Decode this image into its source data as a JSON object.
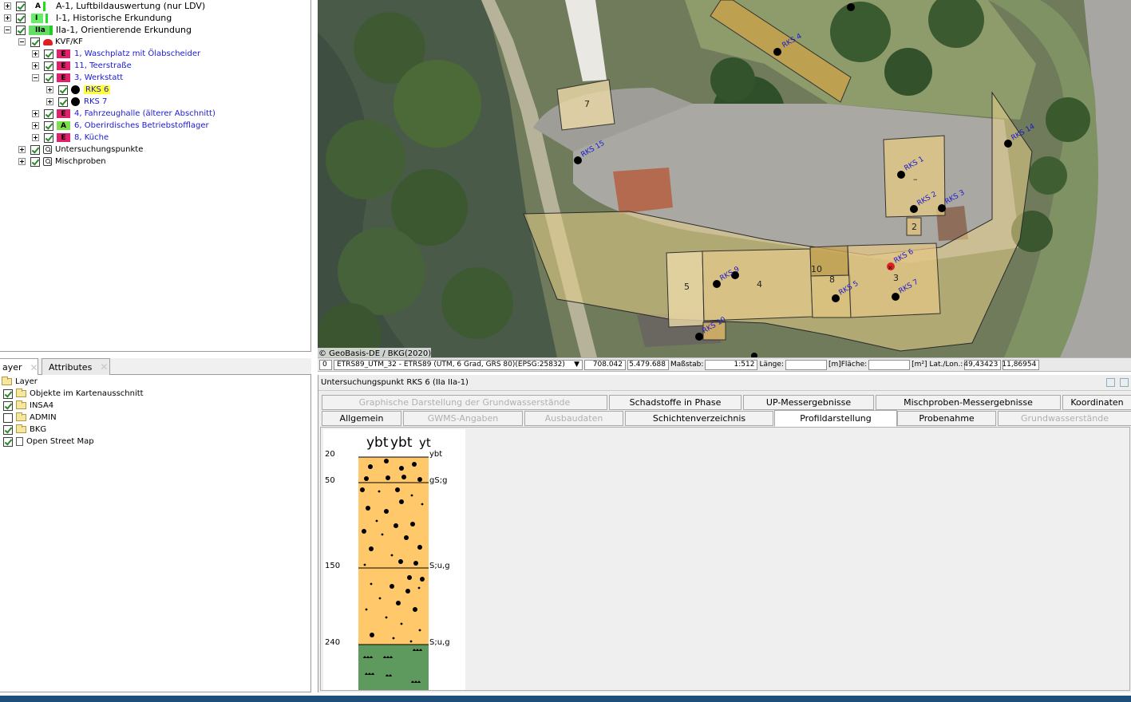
{
  "tree": {
    "items": [
      {
        "phase": "A",
        "label": "A-1, Luftbildauswertung (nur LDV)"
      },
      {
        "phase": "I",
        "label": "I-1, Historische Erkundung"
      },
      {
        "phase": "IIa",
        "label": "IIa-1, Orientierende Erkundung"
      },
      {
        "label": "KVF/KF"
      },
      {
        "badge": "E",
        "label": "1, Waschplatz mit Ölabscheider"
      },
      {
        "badge": "E",
        "label": "11, Teerstraße"
      },
      {
        "badge": "E",
        "label": "3, Werkstatt"
      },
      {
        "label": "RKS 6"
      },
      {
        "label": "RKS 7"
      },
      {
        "badge": "E",
        "label": "4, Fahrzeughalle (älterer Abschnitt)"
      },
      {
        "badge": "A",
        "label": "6, Oberirdisches Betriebstofflager"
      },
      {
        "badge": "E",
        "label": "8, Küche"
      },
      {
        "label": "Untersuchungspunkte"
      },
      {
        "label": "Mischproben"
      }
    ]
  },
  "layer_tabs": [
    "ayer",
    "Attributes"
  ],
  "layers": [
    {
      "label": "Layer",
      "checked": null
    },
    {
      "label": "Objekte im Kartenausschnitt",
      "checked": true
    },
    {
      "label": "INSA4",
      "checked": true
    },
    {
      "label": "ADMIN",
      "checked": false
    },
    {
      "label": "BKG",
      "checked": true
    },
    {
      "label": "Open Street Map",
      "checked": true
    }
  ],
  "map": {
    "copyright": "© GeoBasis-DE / BKG(2020)",
    "points": [
      "RKS 1",
      "RKS 2",
      "RKS 3",
      "RKS 4",
      "RKS 5",
      "RKS 6",
      "RKS 7",
      "RKS 9",
      "RKS 10",
      "RKS 14",
      "RKS 15"
    ],
    "areas": [
      "2",
      "3",
      "4",
      "5",
      "7",
      "8",
      "10"
    ]
  },
  "statusbar": {
    "zero": "0",
    "crs": "ETRS89_UTM_32 - ETRS89 (UTM, 6 Grad, GRS 80)(EPSG:25832)",
    "x": "708.042",
    "y": "5.479.688",
    "scale_label": "Maßstab:",
    "scale": "1:512",
    "length_label": "Länge:",
    "area_label": "[m]Fläche:",
    "latlon_label": "[m²] Lat./Lon.:",
    "lat": "49,43423",
    "lon": "11,86954"
  },
  "detail": {
    "title": "Untersuchungspunkt RKS 6 (IIa IIa-1)",
    "tabs_row1": [
      "Graphische Darstellung der Grundwasserstände",
      "Schadstoffe in Phase",
      "UP-Messergebnisse",
      "Mischproben-Messergebnisse",
      "Koordinaten"
    ],
    "tabs_row2": [
      "Allgemein",
      "GWMS-Angaben",
      "Ausbaudaten",
      "Schichtenverzeichnis",
      "Profildarstellung",
      "Probenahme",
      "Grundwasserstände"
    ],
    "active_tab": "Profildarstellung",
    "profile": {
      "header": [
        "ybt",
        "ybt",
        "yt"
      ],
      "depths": [
        "20",
        "50",
        "150",
        "240"
      ],
      "layer_labels": [
        "ybt",
        "gS;g",
        "S;u,g",
        "S;u,g"
      ]
    }
  },
  "colors": {
    "accent_blue": "#1a1ad0",
    "badge_e": "#e0206a",
    "badge_a": "#7be04a",
    "sand": "#ffc86a",
    "clay": "#5e9a5e"
  }
}
